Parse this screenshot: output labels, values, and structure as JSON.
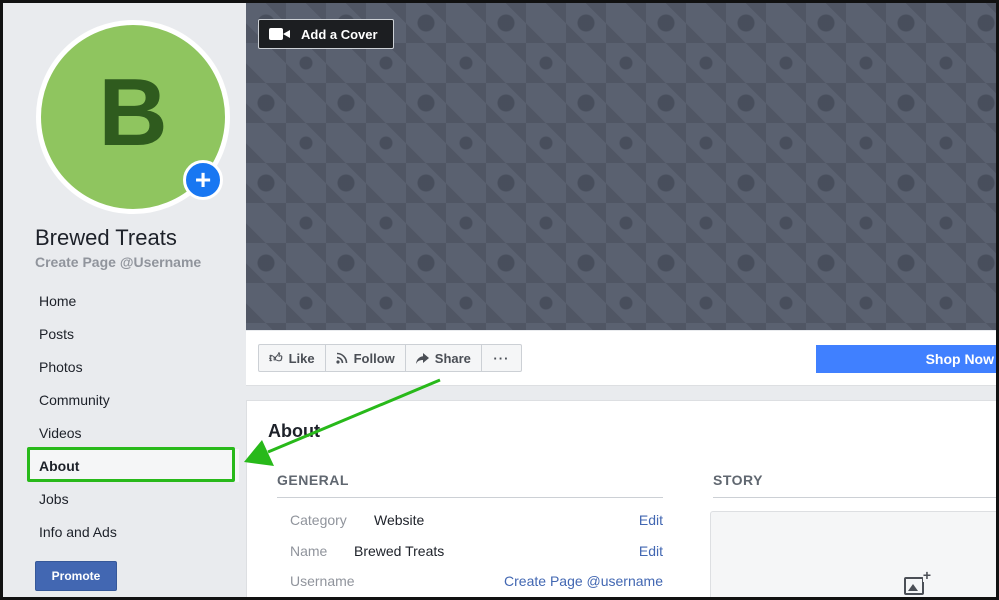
{
  "page": {
    "avatar_letter": "B",
    "name": "Brewed Treats",
    "username_prompt": "Create Page @Username"
  },
  "nav": {
    "items": [
      {
        "label": "Home"
      },
      {
        "label": "Posts"
      },
      {
        "label": "Photos"
      },
      {
        "label": "Community"
      },
      {
        "label": "Videos"
      },
      {
        "label": "About"
      },
      {
        "label": "Jobs"
      },
      {
        "label": "Info and Ads"
      }
    ],
    "active": "About"
  },
  "promote_label": "Promote",
  "cover": {
    "add_cover_label": "Add a Cover",
    "icon": "video-camera-icon"
  },
  "actions": {
    "like": "Like",
    "follow": "Follow",
    "share": "Share",
    "more": "···",
    "shop_now": "Shop Now"
  },
  "about": {
    "title": "About",
    "general_heading": "GENERAL",
    "story_heading": "STORY",
    "rows": [
      {
        "label": "Category",
        "value": "Website",
        "action": "Edit"
      },
      {
        "label": "Name",
        "value": "Brewed Treats",
        "action": "Edit"
      },
      {
        "label": "Username",
        "value": "",
        "action": "Create Page @username"
      }
    ]
  },
  "colors": {
    "accent": "#4267b2",
    "shop_button": "#4080ff",
    "avatar_bg": "#8fc55f",
    "annotation": "#28b91a"
  }
}
